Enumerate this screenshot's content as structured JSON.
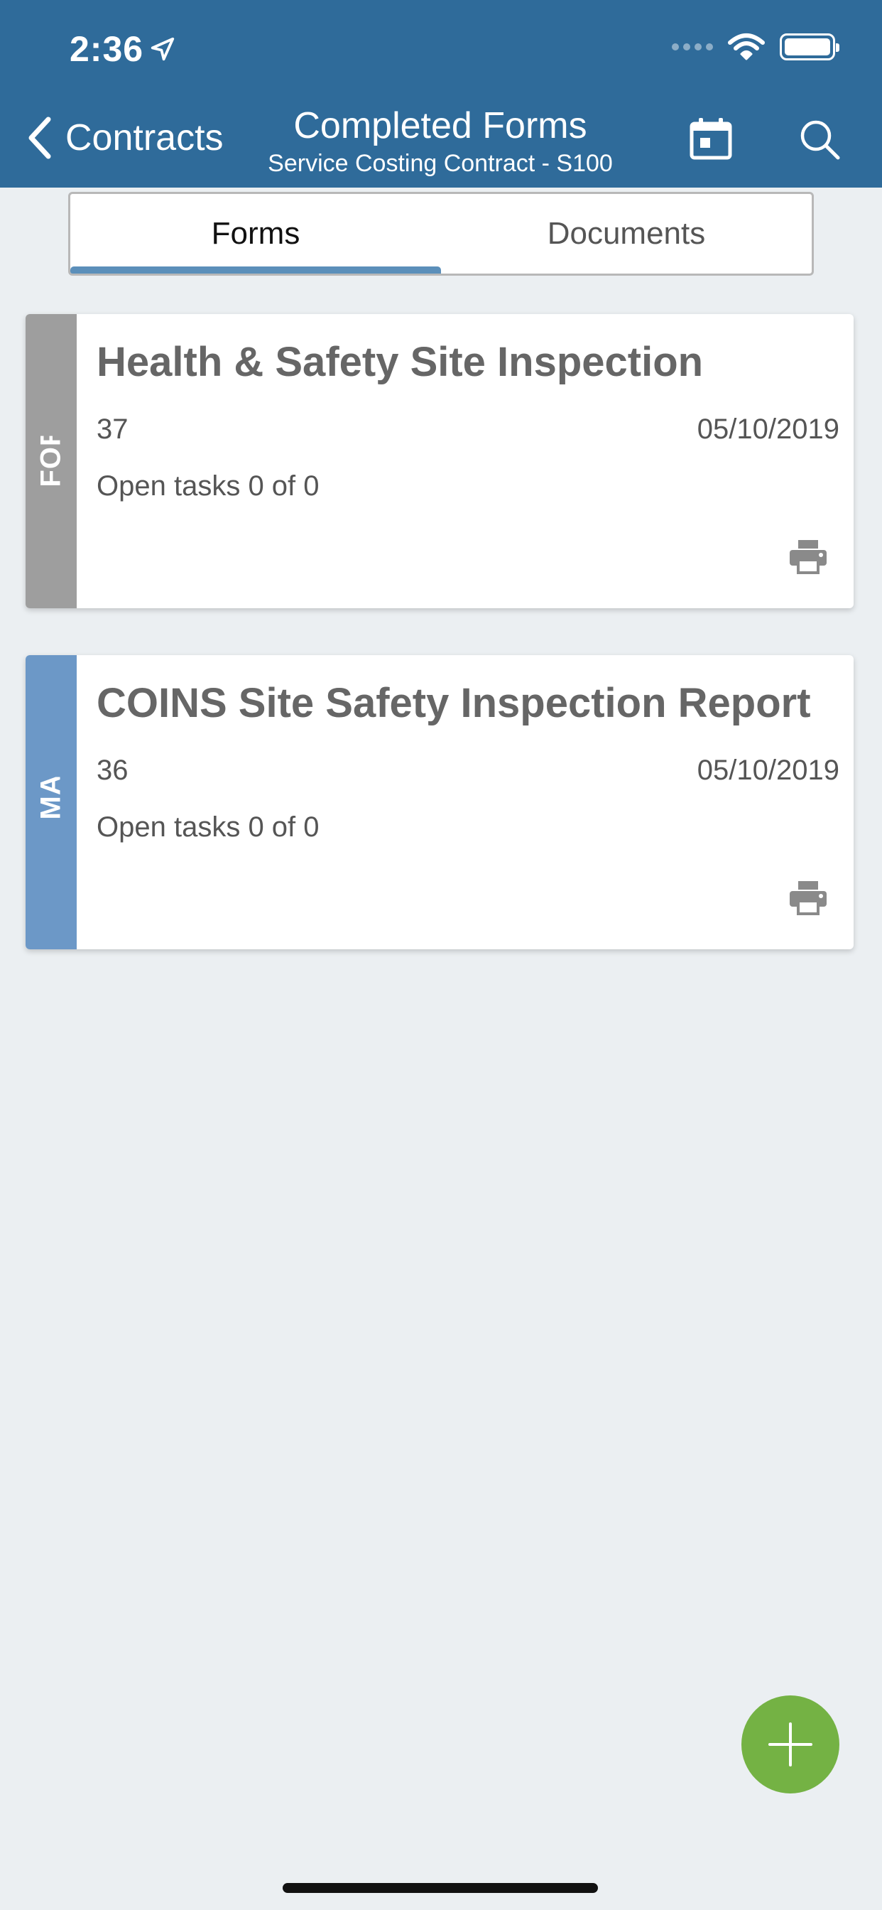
{
  "status_bar": {
    "time": "2:36"
  },
  "nav": {
    "back_label": "Contracts",
    "title": "Completed Forms",
    "subtitle": "Service Costing Contract - S100"
  },
  "tabs": [
    {
      "label": "Forms",
      "active": true
    },
    {
      "label": "Documents",
      "active": false
    }
  ],
  "cards": [
    {
      "status": "FORM COMPLETE",
      "status_color": "#9e9e9e",
      "title": "Health & Safety Site Inspection",
      "number": "37",
      "date": "05/10/2019",
      "tasks": "Open tasks 0 of 0"
    },
    {
      "status": "MANAGER REVIEW",
      "status_color": "#6c98c7",
      "title": "COINS Site Safety Inspection Report",
      "number": "36",
      "date": "05/10/2019",
      "tasks": "Open tasks 0 of 0"
    }
  ],
  "colors": {
    "header": "#2f6b9a",
    "fab": "#74b244",
    "tab_indicator": "#5b8fba"
  }
}
